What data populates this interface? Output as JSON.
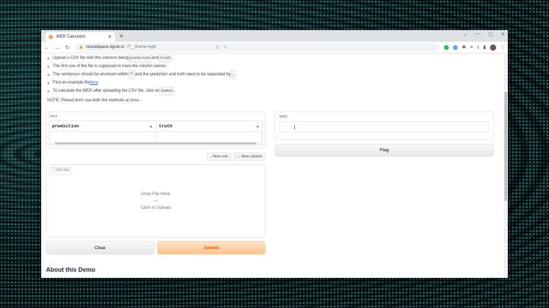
{
  "browser": {
    "tab_title": "WER Calculator",
    "new_tab": "+",
    "url_host": "neuralspace.ngrok.io",
    "url_path": "/?__theme=light",
    "win_controls": [
      "⌄",
      "—",
      "▢",
      "✕"
    ]
  },
  "instructions": [
    {
      "pre": "Upload a CSV file with the columns being ",
      "code1": "prediction",
      "mid": " and ",
      "code2": "truth",
      "post": "."
    },
    {
      "text": "The first row of the file is supposed to have the column names."
    },
    {
      "pre": "The sentences should be enclosed within ",
      "code1": "\"\"",
      "mid": " and the prediction and truth need to be separated by ",
      "code2": ",",
      "post": "."
    },
    {
      "pre": "Find an example file ",
      "link": "here",
      "post": "."
    },
    {
      "pre": "To calculate the WER after uploading the CSV file, click on ",
      "code1": "Submit",
      "post": "."
    }
  ],
  "note": "NOTE: Pleasd don't use both the methods at once.",
  "input": {
    "label": "Input",
    "columns": [
      "prediction",
      "truth"
    ],
    "sort_icon": "▲",
    "new_row": "↓ New row",
    "new_column": "→ New column",
    "file_tag": "CSV File",
    "drop_text": "Drop File Here",
    "or_text": "- or -",
    "click_text": "Click to Upload",
    "clear": "Clear",
    "submit": "Submit"
  },
  "output": {
    "label": "WER",
    "value": "",
    "flag": "Flag"
  },
  "about_title": "About this Demo",
  "colors": {
    "accent": "#ea580c",
    "primary_bg": "#f9c38c"
  }
}
